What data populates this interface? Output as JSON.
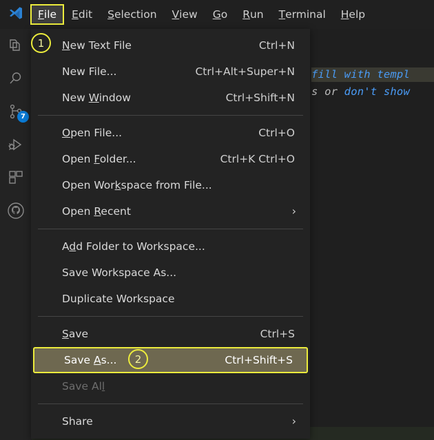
{
  "app": {
    "name": "Visual Studio Code",
    "logo_icon": "vscode-logo-icon"
  },
  "menubar": {
    "items": [
      {
        "label": "File",
        "mnemonic": "F",
        "active": true
      },
      {
        "label": "Edit",
        "mnemonic": "E",
        "active": false
      },
      {
        "label": "Selection",
        "mnemonic": "S",
        "active": false
      },
      {
        "label": "View",
        "mnemonic": "V",
        "active": false
      },
      {
        "label": "Go",
        "mnemonic": "G",
        "active": false
      },
      {
        "label": "Run",
        "mnemonic": "R",
        "active": false
      },
      {
        "label": "Terminal",
        "mnemonic": "T",
        "active": false
      },
      {
        "label": "Help",
        "mnemonic": "H",
        "active": false
      }
    ]
  },
  "activitybar": {
    "items": [
      {
        "name": "explorer-icon",
        "tooltip": "Explorer"
      },
      {
        "name": "search-icon",
        "tooltip": "Search"
      },
      {
        "name": "source-control-icon",
        "tooltip": "Source Control",
        "badge": "7"
      },
      {
        "name": "run-and-debug-icon",
        "tooltip": "Run and Debug"
      },
      {
        "name": "extensions-icon",
        "tooltip": "Extensions"
      },
      {
        "name": "github-account-icon",
        "tooltip": "Accounts"
      }
    ],
    "scm_badge": "7"
  },
  "file_menu": {
    "groups": [
      {
        "items": [
          {
            "label_pre": "",
            "mnemonic": "N",
            "label_post": "ew Text File",
            "accel": "Ctrl+N",
            "disabled": false,
            "submenu": false
          },
          {
            "label_pre": "New File...",
            "mnemonic": "",
            "label_post": "",
            "accel": "Ctrl+Alt+Super+N",
            "disabled": false,
            "submenu": false
          },
          {
            "label_pre": "New ",
            "mnemonic": "W",
            "label_post": "indow",
            "accel": "Ctrl+Shift+N",
            "disabled": false,
            "submenu": false
          }
        ]
      },
      {
        "items": [
          {
            "label_pre": "",
            "mnemonic": "O",
            "label_post": "pen File...",
            "accel": "Ctrl+O",
            "disabled": false,
            "submenu": false
          },
          {
            "label_pre": "Open ",
            "mnemonic": "F",
            "label_post": "older...",
            "accel": "Ctrl+K Ctrl+O",
            "disabled": false,
            "submenu": false
          },
          {
            "label_pre": "Open Wor",
            "mnemonic": "k",
            "label_post": "space from File...",
            "accel": "",
            "disabled": false,
            "submenu": false
          },
          {
            "label_pre": "Open ",
            "mnemonic": "R",
            "label_post": "ecent",
            "accel": "",
            "disabled": false,
            "submenu": true
          }
        ]
      },
      {
        "items": [
          {
            "label_pre": "A",
            "mnemonic": "d",
            "label_post": "d Folder to Workspace...",
            "accel": "",
            "disabled": false,
            "submenu": false
          },
          {
            "label_pre": "Save Workspace As...",
            "mnemonic": "",
            "label_post": "",
            "accel": "",
            "disabled": false,
            "submenu": false
          },
          {
            "label_pre": "Duplicate Workspace",
            "mnemonic": "",
            "label_post": "",
            "accel": "",
            "disabled": false,
            "submenu": false
          }
        ]
      },
      {
        "items": [
          {
            "label_pre": "",
            "mnemonic": "S",
            "label_post": "ave",
            "accel": "Ctrl+S",
            "disabled": false,
            "submenu": false
          },
          {
            "label_pre": "Save ",
            "mnemonic": "A",
            "label_post": "s...",
            "accel": "Ctrl+Shift+S",
            "disabled": false,
            "submenu": false,
            "highlighted": true
          },
          {
            "label_pre": "Save Al",
            "mnemonic": "l",
            "label_post": "",
            "accel": "",
            "disabled": true,
            "submenu": false
          }
        ]
      },
      {
        "items": [
          {
            "label_pre": "Share",
            "mnemonic": "",
            "label_post": "",
            "accel": "",
            "disabled": false,
            "submenu": true
          }
        ]
      }
    ],
    "submenu_arrow_glyph": "›"
  },
  "editor": {
    "lines": [
      {
        "segments": [
          {
            "text": "fill with templ",
            "color": "blue"
          }
        ]
      },
      {
        "segments": [
          {
            "text": "s or ",
            "color": "grey"
          },
          {
            "text": "don't show",
            "color": "blue"
          }
        ]
      }
    ],
    "line1_text": "fill with templ",
    "line2_grey": "s or ",
    "line2_blue": "don't show"
  },
  "annotations": [
    {
      "number": "1",
      "target": "menubar-item-file"
    },
    {
      "number": "2",
      "target": "menu-item-save-as"
    }
  ],
  "colors": {
    "accent_yellow": "#ecec3c",
    "highlight_bg": "#6e6850",
    "menu_bg": "#232323",
    "titlebar_bg": "#202020",
    "badge_blue": "#0a7ad4",
    "code_blue": "#4a9bf5"
  }
}
